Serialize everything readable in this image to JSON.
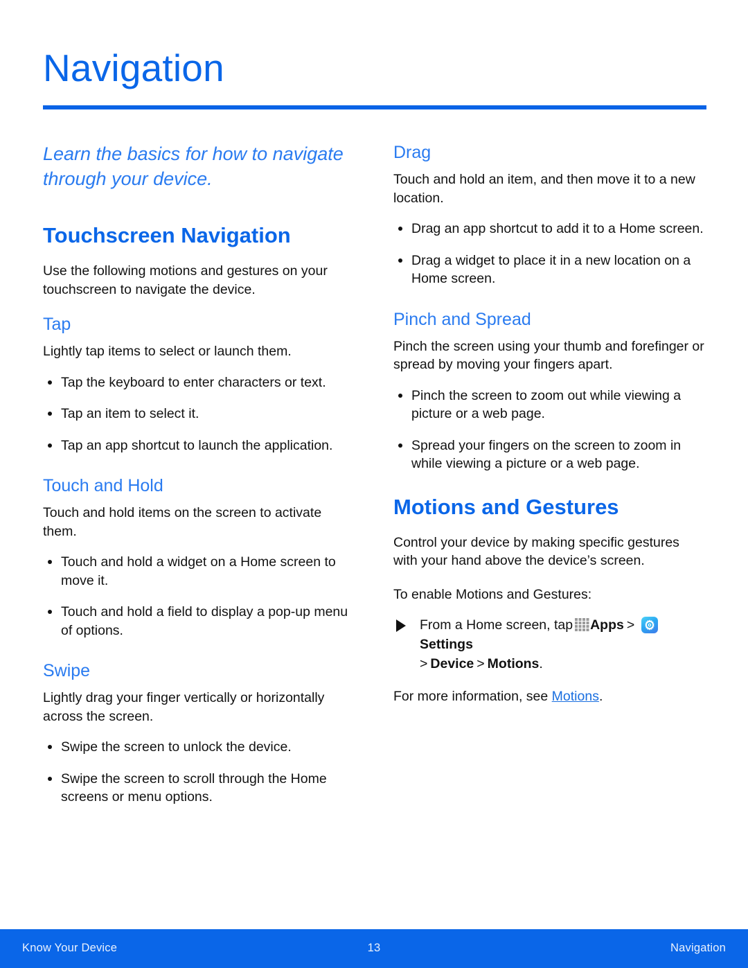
{
  "document": {
    "title": "Navigation",
    "accent_color": "#0a66e8",
    "subheading_color": "#2a7bf0"
  },
  "intro": {
    "lede": "Learn the basics for how to navigate through your device."
  },
  "left_column": {
    "section": {
      "heading": "Touchscreen Navigation",
      "intro": "Use the following motions and gestures on your touchscreen to navigate the device."
    },
    "subsections": [
      {
        "heading": "Tap",
        "intro": "Lightly tap items to select or launch them.",
        "bullets": [
          "Tap the keyboard to enter characters or text.",
          "Tap an item to select it.",
          "Tap an app shortcut to launch the application."
        ]
      },
      {
        "heading": "Touch and Hold",
        "intro": "Touch and hold items on the screen to activate them.",
        "bullets": [
          "Touch and hold a widget on a Home screen to move it.",
          "Touch and hold a field to display a pop-up menu of options."
        ]
      },
      {
        "heading": "Swipe",
        "intro": "Lightly drag your finger vertically or horizontally across the screen.",
        "bullets": [
          "Swipe the screen to unlock the device.",
          "Swipe the screen to scroll through the Home screens or menu options."
        ]
      }
    ]
  },
  "right_column": {
    "subsections": [
      {
        "heading": "Drag",
        "intro": "Touch and hold an item, and then move it to a new location.",
        "bullets": [
          "Drag an app shortcut to add it to a Home screen.",
          "Drag a widget to place it in a new location on a Home screen."
        ]
      },
      {
        "heading": "Pinch and Spread",
        "intro": "Pinch the screen using your thumb and forefinger or spread by moving your fingers apart.",
        "bullets": [
          "Pinch the screen to zoom out while viewing a picture or a web page.",
          "Spread your fingers on the screen to zoom in while viewing a picture or a web page."
        ]
      }
    ],
    "motions_section": {
      "heading": "Motions and Gestures",
      "intro": "Control your device by making specific gestures with your hand above the device’s screen.",
      "enable_label": "To enable Motions and Gestures:",
      "step": {
        "lead": "From a Home screen, tap",
        "apps_icon_name": "apps-grid-icon",
        "apps_label": "Apps",
        "separator_1": ">",
        "settings_icon_name": "settings-gear-icon",
        "settings_label": "Settings",
        "separator_2": ">",
        "device_label": "Device",
        "separator_3": ">",
        "motions_label": "Motions",
        "period": "."
      },
      "more_info": {
        "prefix": "For more information, see ",
        "link_text": "Motions",
        "suffix": "."
      }
    }
  },
  "footer": {
    "left": "Know Your Device",
    "page_number": "13",
    "right": "Navigation"
  }
}
